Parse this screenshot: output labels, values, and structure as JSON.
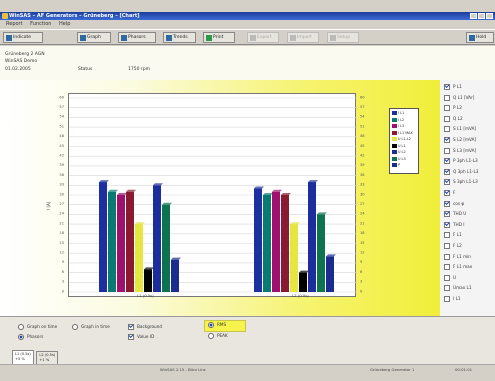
{
  "window": {
    "title": "WinSAS – AF Generators – Grüneberg – [Chart]"
  },
  "menu": [
    "Report",
    "Function",
    "Help"
  ],
  "toolbar": {
    "buttons": [
      {
        "label": "Indicate",
        "enabled": true
      },
      {
        "label": "Graph",
        "enabled": true
      },
      {
        "label": "Phasors",
        "enabled": true
      },
      {
        "label": "Trends",
        "enabled": true
      },
      {
        "label": "Print",
        "enabled": true
      },
      {
        "label": "Export",
        "enabled": false
      },
      {
        "label": "Import",
        "enabled": false
      },
      {
        "label": "Setup",
        "enabled": false
      }
    ],
    "right_button": "Hold"
  },
  "info": {
    "line1": "Grüneberg 2 AGN",
    "line2": "WinSAS Demo",
    "date": "01.02.2005",
    "status_label": "Status",
    "status_value": "1750 rpm"
  },
  "chart_data": {
    "type": "bar",
    "categories": [
      "L1 (0.5s)",
      "L2 (0.5s)"
    ],
    "series": [
      {
        "name": "I L1",
        "color": "#1e2fa0",
        "values": [
          34,
          32
        ]
      },
      {
        "name": "I L2",
        "color": "#0a7a73",
        "values": [
          31,
          30
        ]
      },
      {
        "name": "I L3",
        "color": "#a0106e",
        "values": [
          30,
          31
        ]
      },
      {
        "name": "I L1 MAX",
        "color": "#8a1a30",
        "values": [
          31,
          30
        ]
      },
      {
        "name": "U L1-L2",
        "color": "#e6e640",
        "values": [
          21,
          21
        ]
      },
      {
        "name": "U L1",
        "color": "#000000",
        "values": [
          7,
          6
        ]
      },
      {
        "name": "U L2",
        "color": "#1c2e9c",
        "values": [
          33,
          34
        ]
      },
      {
        "name": "U L3",
        "color": "#0d7350",
        "values": [
          27,
          24
        ]
      },
      {
        "name": "P",
        "color": "#1b2c8f",
        "values": [
          10,
          11
        ]
      }
    ],
    "left_axis": {
      "min": 0,
      "max": 60,
      "step": 3,
      "ticks": [
        "0",
        "3",
        "6",
        "9",
        "12",
        "15",
        "18",
        "21",
        "24",
        "27",
        "30",
        "33",
        "36",
        "39",
        "42",
        "45",
        "48",
        "51",
        "54",
        "57",
        "60"
      ]
    },
    "right_axis_ticks": [
      "0",
      "3",
      "6",
      "9",
      "12",
      "15",
      "18",
      "21",
      "24",
      "27",
      "30",
      "33",
      "36",
      "39",
      "42",
      "45",
      "48",
      "51",
      "54",
      "57",
      "60"
    ],
    "ylabel": "I [A]",
    "grid": true
  },
  "right_panel": {
    "items": [
      {
        "label": "P L1",
        "checked": true
      },
      {
        "label": "Q L1 [VAr]",
        "checked": false
      },
      {
        "label": "P L2",
        "checked": false
      },
      {
        "label": "Q L2",
        "checked": false
      },
      {
        "label": "S L1 [mVA]",
        "checked": false
      },
      {
        "label": "S L2 [mVA]",
        "checked": true
      },
      {
        "label": "S L3 [mVA]",
        "checked": false
      },
      {
        "label": "P 3ph L1-L3",
        "checked": true
      },
      {
        "label": "Q 3ph L1-L3",
        "checked": true
      },
      {
        "label": "S 3ph L1-L3",
        "checked": true
      },
      {
        "label": "F",
        "checked": true
      },
      {
        "label": "cos φ",
        "checked": true
      },
      {
        "label": "THD U",
        "checked": true
      },
      {
        "label": "THD I",
        "checked": true
      },
      {
        "label": "F L1",
        "checked": false
      },
      {
        "label": "F L2",
        "checked": false
      },
      {
        "label": "F L1 min",
        "checked": false
      },
      {
        "label": "F L1 max",
        "checked": false
      },
      {
        "label": "U",
        "checked": false
      },
      {
        "label": "Umax L1",
        "checked": false
      },
      {
        "label": "I L1",
        "checked": false
      }
    ]
  },
  "options": {
    "left_col": [
      {
        "label": "Graph on time",
        "on": false
      },
      {
        "label": "Phasors",
        "on": true
      }
    ],
    "mid_col": [
      {
        "label": "Graph in time",
        "on": false
      },
      {
        "label": "",
        "on": false
      }
    ],
    "check_col": [
      {
        "label": "Background",
        "checked": true
      },
      {
        "label": "Value ID",
        "checked": true
      }
    ],
    "value_col": [
      {
        "label": "RMS",
        "on": true
      },
      {
        "label": "PEAK",
        "on": false
      }
    ]
  },
  "tabs": [
    {
      "label": "L1 (0.5s)\n+5 %",
      "active": true
    },
    {
      "label": "L2 (0.5s)\n+1 %",
      "active": false
    }
  ],
  "status": {
    "left": "",
    "center": "WinSAS 2.15 - Büro Linz",
    "right1": "Grüneberg Generator 1",
    "right2": "00:01:01"
  },
  "colors": {
    "titlebar": "#1c3f9c",
    "plot_bg_accent": "#f0ee3a",
    "check_color": "#1e46a8"
  }
}
